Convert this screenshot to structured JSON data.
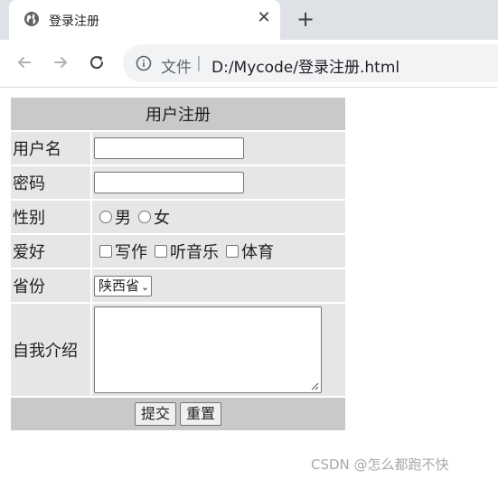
{
  "browser": {
    "tab": {
      "title": "登录注册",
      "close_glyph": "✕"
    },
    "new_tab_glyph": "+",
    "address": {
      "scheme_label": "文件",
      "separator": "|",
      "url": "D:/Mycode/登录注册.html"
    }
  },
  "form": {
    "caption": "用户注册",
    "username_label": "用户名",
    "username_value": "",
    "password_label": "密码",
    "password_value": "",
    "gender": {
      "label": "性别",
      "options": [
        "男",
        "女"
      ]
    },
    "hobbies": {
      "label": "爱好",
      "options": [
        "写作",
        "听音乐",
        "体育"
      ]
    },
    "province": {
      "label": "省份",
      "selected": "陕西省"
    },
    "intro": {
      "label": "自我介绍",
      "value": ""
    },
    "submit_label": "提交",
    "reset_label": "重置"
  },
  "watermark": "CSDN @怎么都跑不快"
}
